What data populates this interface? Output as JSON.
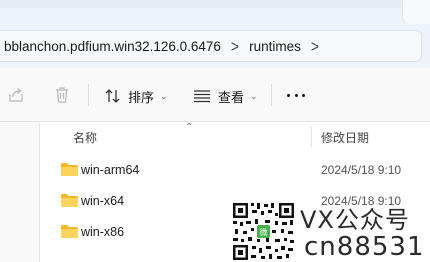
{
  "address": {
    "crumbs": [
      "bblanchon.pdfium.win32.126.0.6476",
      "runtimes"
    ],
    "separator": ">"
  },
  "toolbar": {
    "share_icon": "share-icon",
    "delete_icon": "trash-icon",
    "sort_label": "排序",
    "view_label": "查看",
    "more_icon": "more-dots-icon"
  },
  "columns": {
    "name": "名称",
    "modified": "修改日期"
  },
  "rows": [
    {
      "name": "win-arm64",
      "date": "2024/5/18 9:10",
      "icon": "folder-icon"
    },
    {
      "name": "win-x64",
      "date": "2024/5/18 9:10",
      "icon": "folder-icon"
    },
    {
      "name": "win-x86",
      "date": "",
      "icon": "folder-icon"
    }
  ],
  "watermark": {
    "line1": "VX公众号",
    "line2": "cn88531"
  },
  "colors": {
    "folder": "#f7c948",
    "accent": "#005fb8"
  }
}
